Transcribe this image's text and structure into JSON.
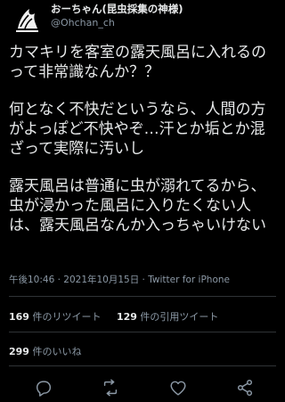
{
  "user": {
    "display_name": "おーちゃん(昆虫採集の神様)",
    "handle": "@Ohchan_ch"
  },
  "tweet": {
    "paragraphs": [
      "カマキリを客室の露天風呂に入れるのって非常識なんか？？",
      "何となく不快だというなら、人間の方がよっぽど不快やぞ…汗とか垢とか混ざって実際に汚いし",
      "露天風呂は普通に虫が溺れてるから、虫が浸かった風呂に入りたくない人は、露天風呂なんか入っちゃいけない"
    ],
    "timestamp": "午後10:46 · 2021年10月15日 · ",
    "source": "Twitter for iPhone"
  },
  "stats": {
    "retweets_count": "169",
    "retweets_label": " 件のリツイート",
    "quotes_count": "129",
    "quotes_label": " 件の引用ツイート",
    "likes_count": "299",
    "likes_label": " 件のいいね"
  },
  "actions": {
    "icons": [
      "reply-icon",
      "retweet-icon",
      "like-icon",
      "share-icon"
    ]
  },
  "colors": {
    "background": "#000000",
    "text": "#e7e9ea",
    "secondary": "#8b98a5",
    "divider": "#2f3336"
  }
}
